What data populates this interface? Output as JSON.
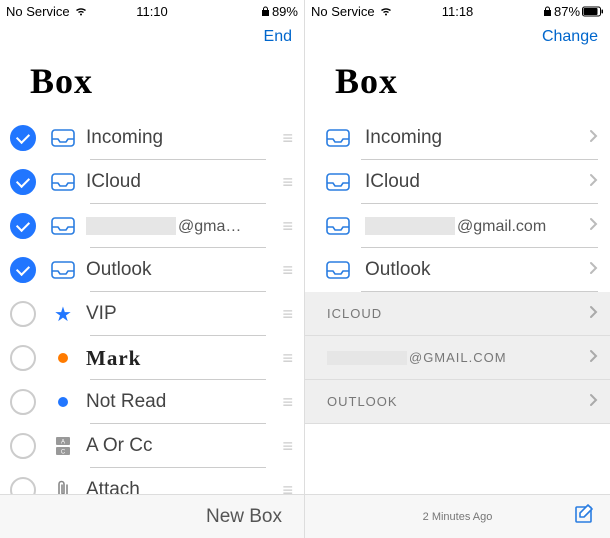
{
  "left": {
    "status": {
      "carrier": "No Service",
      "time": "11:10",
      "battery": "89%"
    },
    "nav_action": "End",
    "title": "Box",
    "items": [
      {
        "label": "Incoming",
        "checked": true,
        "icon": "tray"
      },
      {
        "label": "ICloud",
        "checked": true,
        "icon": "tray"
      },
      {
        "label": "",
        "suffix": "@gma…",
        "checked": true,
        "icon": "tray",
        "redacted": true
      },
      {
        "label": "Outlook",
        "checked": true,
        "icon": "tray"
      },
      {
        "label": "VIP",
        "checked": false,
        "icon": "star"
      },
      {
        "label": "Mark",
        "checked": false,
        "icon": "dot-orange",
        "bold": true
      },
      {
        "label": "Not Read",
        "checked": false,
        "icon": "dot-blue"
      },
      {
        "label": "A Or Cc",
        "checked": false,
        "icon": "acc"
      },
      {
        "label": "Attach",
        "checked": false,
        "icon": "clip"
      }
    ],
    "footer": "New Box"
  },
  "right": {
    "status": {
      "carrier": "No Service",
      "time": "11:18",
      "battery": "87%"
    },
    "nav_action": "Change",
    "title": "Box",
    "items": [
      {
        "label": "Incoming"
      },
      {
        "label": "ICloud"
      },
      {
        "label": "",
        "suffix": "@gmail.com",
        "redacted": true
      },
      {
        "label": "Outlook"
      }
    ],
    "sections": [
      {
        "label": "ICLOUD"
      },
      {
        "label": "",
        "suffix": "@GMAIL.COM",
        "redacted": true
      },
      {
        "label": "OUTLOOK"
      }
    ],
    "footer": "2 Minutes Ago"
  }
}
